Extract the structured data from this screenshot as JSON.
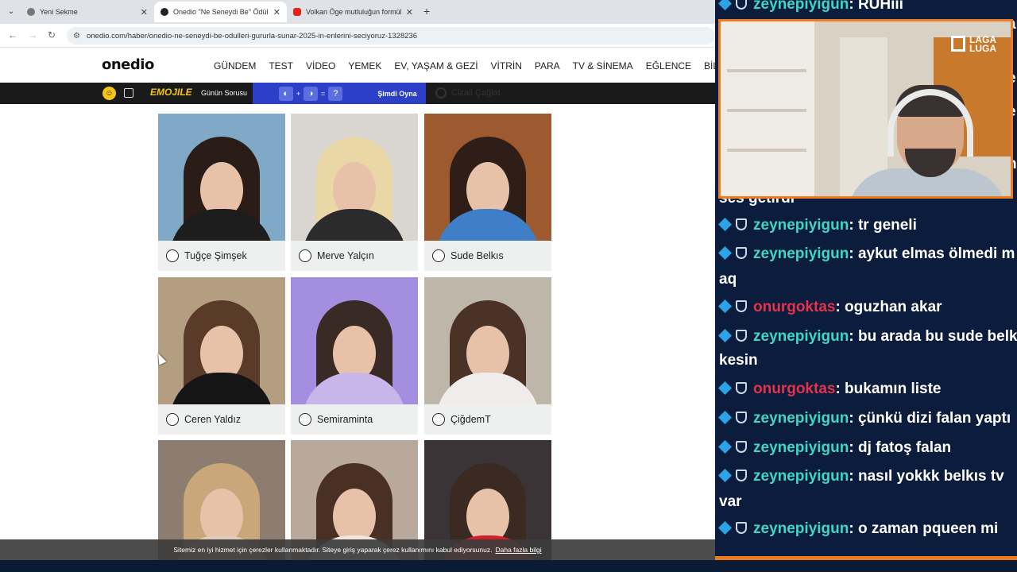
{
  "browser": {
    "tabs": [
      {
        "label": "Yeni Sekme",
        "active": false,
        "icon": "globe-icon"
      },
      {
        "label": "Onedio \"Ne Seneydi Be\" Ödülleri",
        "active": true,
        "icon": "onedio-icon"
      },
      {
        "label": "Volkan Öge mutluluğun formülü",
        "active": false,
        "icon": "youtube-icon"
      }
    ],
    "url": "onedio.com/haber/onedio-ne-seneydi-be-odulleri-gururla-sunar-2025-in-enlerini-seciyoruz-1328236"
  },
  "site": {
    "logo": "onedio",
    "nav": [
      "GÜNDEM",
      "TEST",
      "VİDEO",
      "YEMEK",
      "EV, YAŞAM & GEZİ",
      "VİTRİN",
      "PARA",
      "TV & SİNEMA",
      "EĞLENCE",
      "BİLGİS"
    ],
    "emojibar": {
      "logo": "EMOJILE",
      "question": "Günün Sorusu",
      "play": "Şimdi Oyna",
      "game_ops": [
        "+",
        "=",
        "?"
      ],
      "ghost_option": "Cizali Çağlat"
    }
  },
  "poll": {
    "options": [
      {
        "name": "Tuğçe Şimşek",
        "hair": "#2a1c16",
        "torso": "#1d1d1d",
        "bg": "#7fa9c7"
      },
      {
        "name": "Merve Yalçın",
        "hair": "#e9d7a6",
        "torso": "#2b2b2b",
        "bg": "#d9d6d2"
      },
      {
        "name": "Sude Belkıs",
        "hair": "#2e1e17",
        "torso": "#3f7fc7",
        "bg": "#9c5a2e"
      },
      {
        "name": "Ceren Yaldız",
        "hair": "#5a3a28",
        "torso": "#151515",
        "bg": "#b39e82"
      },
      {
        "name": "Semiraminta",
        "hair": "#3a2a25",
        "torso": "#c8b6ea",
        "bg": "#a48ee0"
      },
      {
        "name": "ÇiğdemT",
        "hair": "#4a3226",
        "torso": "#f1ecec",
        "bg": "#bfb6aa"
      },
      {
        "name": "",
        "hair": "#c9a77a",
        "torso": "#e2cbb4",
        "bg": "#8d7d70"
      },
      {
        "name": "",
        "hair": "#4a3024",
        "torso": "#efe6dc",
        "bg": "#b8a99c"
      },
      {
        "name": "",
        "hair": "#3b2a22",
        "torso": "#d11f2c",
        "bg": "#3a3436"
      }
    ]
  },
  "cookie": {
    "text": "Sitemiz en iyi hizmet için çerezler kullanmaktadır. Siteye giriş yaparak çerez kullanımını kabul ediyorsunuz.",
    "link": "Daha fazla bilgi"
  },
  "stream": {
    "webcam_logo": [
      "LAGA",
      "LUGA"
    ],
    "chat": [
      {
        "user": "zeynepiyigun",
        "color": "teal",
        "msg": ": RUHiii"
      },
      {
        "user": "",
        "color": "",
        "msg": "ses getirdi"
      },
      {
        "user": "zeynepiyigun",
        "color": "teal",
        "msg": ": tr geneli"
      },
      {
        "user": "zeynepiyigun",
        "color": "teal",
        "msg": ": aykut elmas ölmedi m"
      },
      {
        "user": "",
        "color": "",
        "msg": "aq"
      },
      {
        "user": "onurgoktas",
        "color": "red",
        "msg": ": oguzhan akar"
      },
      {
        "user": "zeynepiyigun",
        "color": "teal",
        "msg": ": bu arada bu sude belk"
      },
      {
        "user": "",
        "color": "",
        "msg": "kesin"
      },
      {
        "user": "onurgoktas",
        "color": "red",
        "msg": ": bukamın liste"
      },
      {
        "user": "zeynepiyigun",
        "color": "teal",
        "msg": ": çünkü dizi falan yaptı"
      },
      {
        "user": "zeynepiyigun",
        "color": "teal",
        "msg": ": dj fatoş falan"
      },
      {
        "user": "zeynepiyigun",
        "color": "teal",
        "msg": ": nasıl yokkk belkıs tv"
      },
      {
        "user": "",
        "color": "",
        "msg": "var"
      },
      {
        "user": "zeynepiyigun",
        "color": "teal",
        "msg": ": o zaman pqueen mi"
      }
    ],
    "right_edge_fragments": [
      "ar",
      "e",
      "e",
      "h"
    ]
  },
  "colors": {
    "teal_user": "#3fd6c2",
    "red_user": "#e5334b",
    "webcam_border": "#f07a1e",
    "chat_bg": "#0c1c3d"
  }
}
